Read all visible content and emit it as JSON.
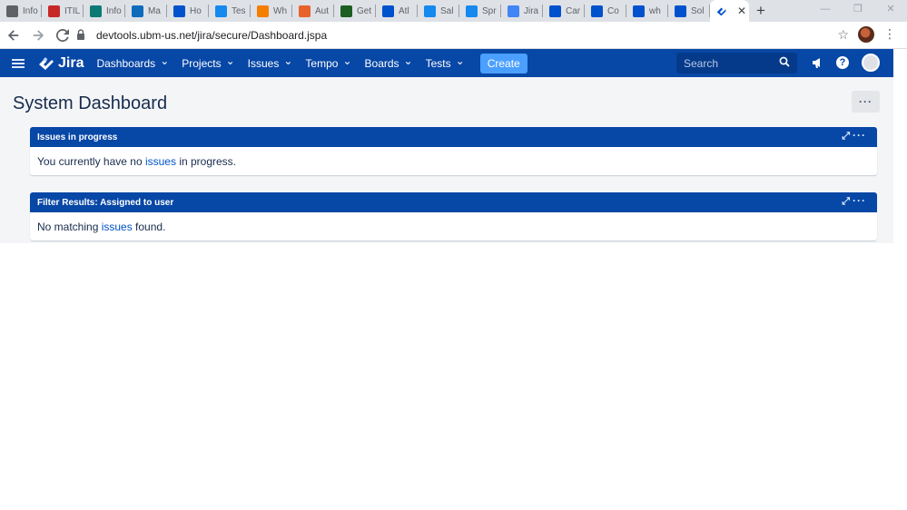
{
  "browser": {
    "tabs": [
      {
        "label": "Info",
        "icon": "clock-icon",
        "color": "#5f6368"
      },
      {
        "label": "ITIL",
        "icon": "now-icon",
        "color": "#c62828"
      },
      {
        "label": "Info",
        "icon": "sharepoint-icon",
        "color": "#0b7a75"
      },
      {
        "label": "Ma",
        "icon": "outlook-icon",
        "color": "#0f6cbd"
      },
      {
        "label": "Ho",
        "icon": "atlassian-icon",
        "color": "#0052cc"
      },
      {
        "label": "Tes",
        "icon": "cloud-icon",
        "color": "#1589ee"
      },
      {
        "label": "Wh",
        "icon": "blogger-icon",
        "color": "#f57d00"
      },
      {
        "label": "Aut",
        "icon": "aura-icon",
        "color": "#e8632b"
      },
      {
        "label": "Get",
        "icon": "mountain-icon",
        "color": "#1b5e20"
      },
      {
        "label": "Atl",
        "icon": "atlassian-icon",
        "color": "#0052cc"
      },
      {
        "label": "Sal",
        "icon": "salesforce-icon",
        "color": "#1589ee"
      },
      {
        "label": "Spr",
        "icon": "salesforce-icon",
        "color": "#1589ee"
      },
      {
        "label": "Jira",
        "icon": "google-icon",
        "color": "#4285f4"
      },
      {
        "label": "Car",
        "icon": "atlassian-icon",
        "color": "#0052cc"
      },
      {
        "label": "Co",
        "icon": "atlassian-icon",
        "color": "#0052cc"
      },
      {
        "label": "wh",
        "icon": "atlassian-icon",
        "color": "#0052cc"
      },
      {
        "label": "Sol",
        "icon": "atlassian-icon",
        "color": "#0052cc"
      }
    ],
    "active_tab_icon": "jira-icon",
    "new_tab": "+",
    "url": "devtools.ubm-us.net/jira/secure/Dashboard.jspa"
  },
  "jira": {
    "product": "Jira",
    "menu": [
      {
        "label": "Dashboards"
      },
      {
        "label": "Projects"
      },
      {
        "label": "Issues"
      },
      {
        "label": "Tempo"
      },
      {
        "label": "Boards"
      },
      {
        "label": "Tests"
      }
    ],
    "create_label": "Create",
    "search_placeholder": "Search",
    "help_label": "?"
  },
  "dashboard": {
    "title": "System Dashboard",
    "more_label": "···",
    "gadgets": [
      {
        "title": "Issues in progress",
        "text_before": "You currently have no ",
        "link": "issues",
        "text_after": " in progress."
      },
      {
        "title": "Filter Results: Assigned to user",
        "text_before": "No matching ",
        "link": "issues",
        "text_after": " found."
      }
    ]
  },
  "colors": {
    "jira_nav": "#0747a6",
    "create_button": "#4a9fff",
    "link": "#0052cc",
    "page_bg": "#f4f5f7"
  }
}
